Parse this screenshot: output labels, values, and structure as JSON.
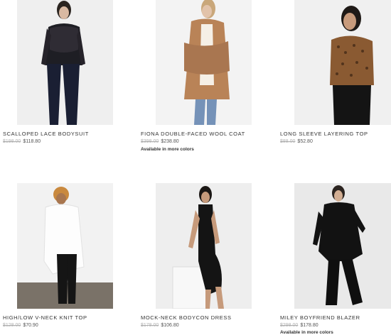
{
  "products": [
    {
      "name": "SCALLOPED LACE BODYSUIT",
      "was": "$198.00",
      "now": "$118.80",
      "more": ""
    },
    {
      "name": "FIONA DOUBLE-FACED WOOL COAT",
      "was": "$398.00",
      "now": "$238.80",
      "more": "Available in more colors"
    },
    {
      "name": "LONG SLEEVE LAYERING TOP",
      "was": "$88.00",
      "now": "$52.80",
      "more": ""
    },
    {
      "name": "HIGH/LOW V-NECK KNIT TOP",
      "was": "$128.00",
      "now": "$70.90",
      "more": ""
    },
    {
      "name": "MOCK-NECK BODYCON DRESS",
      "was": "$178.00",
      "now": "$106.80",
      "more": ""
    },
    {
      "name": "MILEY BOYFRIEND BLAZER",
      "was": "$298.00",
      "now": "$178.80",
      "more": "Available in more colors"
    }
  ]
}
